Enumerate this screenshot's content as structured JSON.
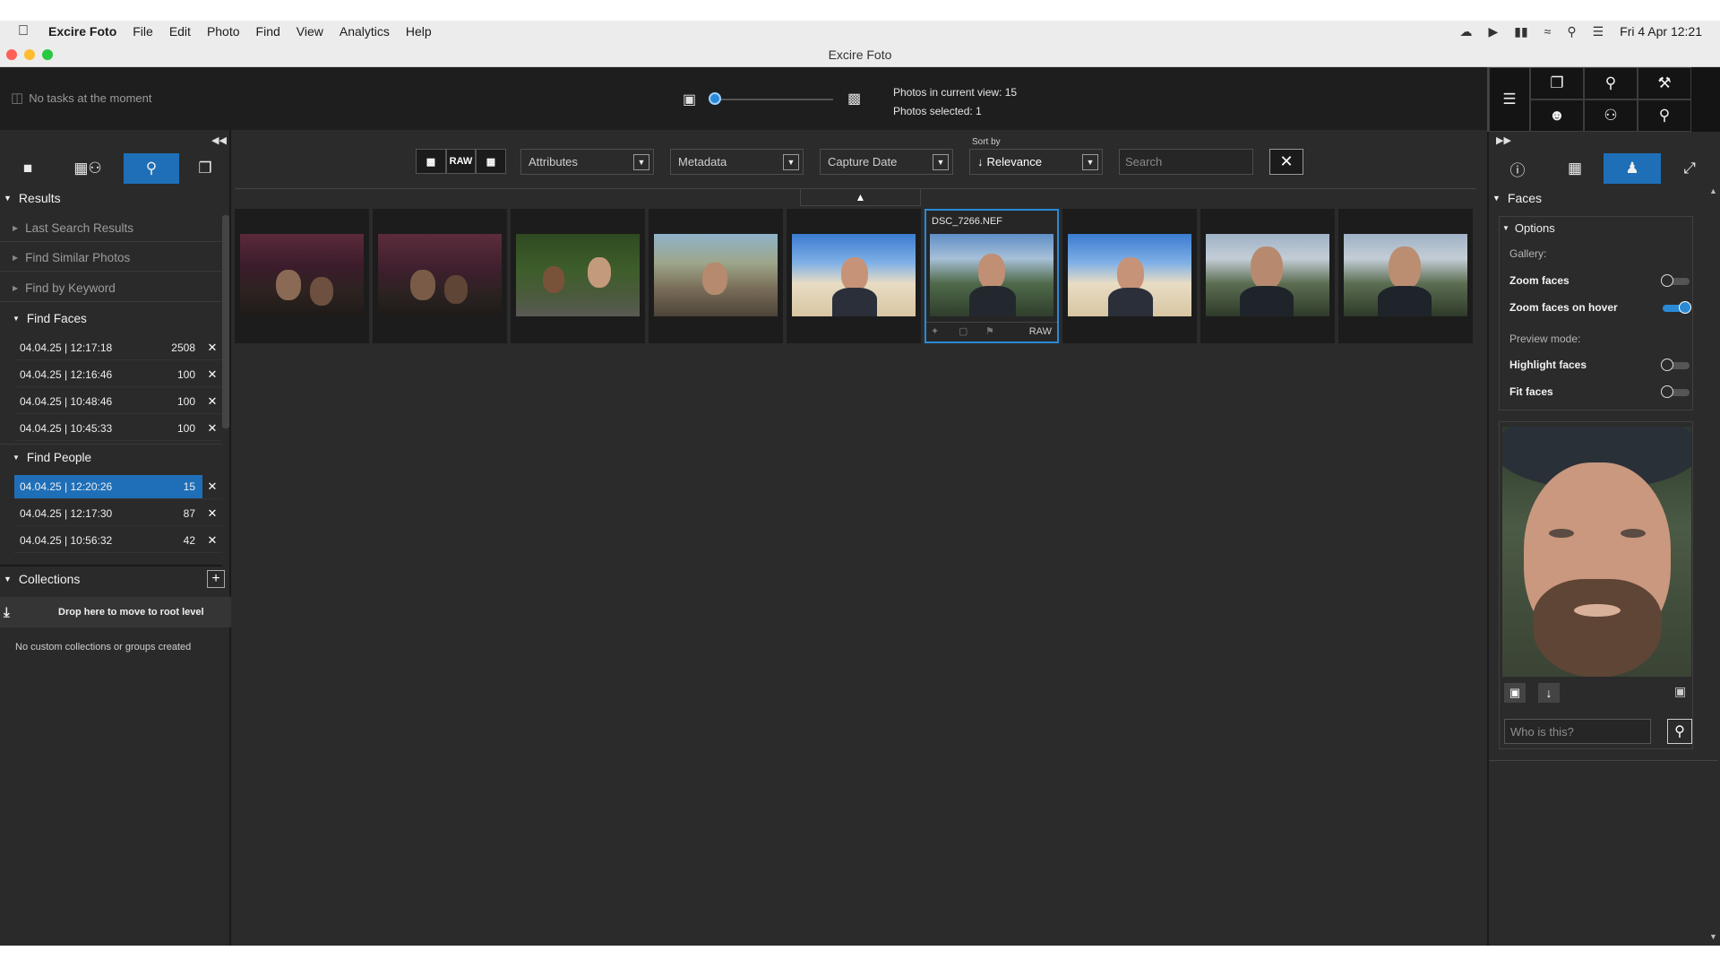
{
  "menubar": {
    "app_name": "Excire Foto",
    "menus": [
      "File",
      "Edit",
      "Photo",
      "Find",
      "View",
      "Analytics",
      "Help"
    ],
    "clock": "Fri 4 Apr  12:21"
  },
  "window": {
    "title": "Excire Foto"
  },
  "toolbar": {
    "tasks_text": "No tasks at the moment",
    "photos_in_view": "Photos in current view: 15",
    "photos_selected": "Photos selected: 1",
    "thumb_size_level": 0.0
  },
  "left_panel": {
    "results_header": "Results",
    "results_items": [
      "Last Search Results",
      "Find Similar Photos",
      "Find by Keyword"
    ],
    "find_faces": {
      "label": "Find Faces",
      "rows": [
        {
          "date": "04.04.25 | 12:17:18",
          "count": "2508"
        },
        {
          "date": "04.04.25 | 12:16:46",
          "count": "100"
        },
        {
          "date": "04.04.25 | 10:48:46",
          "count": "100"
        },
        {
          "date": "04.04.25 | 10:45:33",
          "count": "100"
        }
      ]
    },
    "find_people": {
      "label": "Find People",
      "rows": [
        {
          "date": "04.04.25 | 12:20:26",
          "count": "15"
        },
        {
          "date": "04.04.25 | 12:17:30",
          "count": "87"
        },
        {
          "date": "04.04.25 | 10:56:32",
          "count": "42"
        }
      ]
    },
    "collections_header": "Collections",
    "drop_text": "Drop here to move to root level",
    "empty_text": "No custom collections or groups created"
  },
  "filter_bar": {
    "raw_label": "RAW",
    "attributes": "Attributes",
    "metadata": "Metadata",
    "capture_date": "Capture Date",
    "sort_by_label": "Sort by",
    "sort_value": "Relevance",
    "search_placeholder": "Search"
  },
  "gallery": {
    "selected_filename": "DSC_7266.NEF",
    "selected_badge": "RAW",
    "thumbnail_count": 9
  },
  "right_panel": {
    "faces_header": "Faces",
    "options_header": "Options",
    "gallery_label": "Gallery:",
    "zoom_faces": "Zoom faces",
    "zoom_faces_on_hover": "Zoom faces on hover",
    "preview_mode_label": "Preview mode:",
    "highlight_faces": "Highlight faces",
    "fit_faces": "Fit faces",
    "who_placeholder": "Who is this?"
  },
  "colors": {
    "accent": "#1e6fb8",
    "background": "#2b2b2b",
    "toolbar": "#1e1e1e"
  }
}
